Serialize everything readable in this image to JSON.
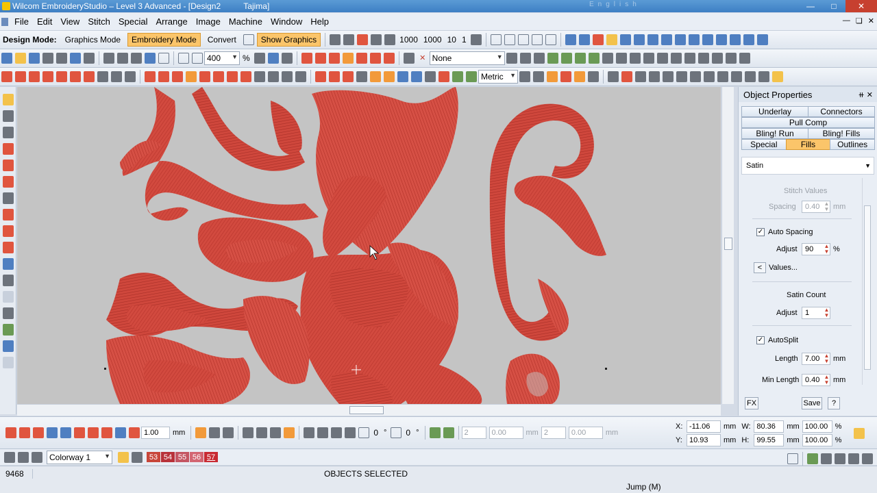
{
  "window": {
    "title": "Wilcom EmbroideryStudio – Level 3 Advanced - [Design2          Tajima]",
    "faint_text": "English"
  },
  "menu": [
    "File",
    "Edit",
    "View",
    "Stitch",
    "Special",
    "Arrange",
    "Image",
    "Machine",
    "Window",
    "Help"
  ],
  "toolbar1": {
    "design_mode_label": "Design Mode:",
    "graphics_mode": "Graphics Mode",
    "embroidery_mode": "Embroidery Mode",
    "convert": "Convert",
    "show_graphics": "Show Graphics",
    "digits": [
      "1000",
      "1000",
      "10",
      "1"
    ]
  },
  "toolbar2": {
    "zoom_value": "400",
    "zoom_unit": "%",
    "effect_none": "None"
  },
  "toolbar3": {
    "units": "Metric"
  },
  "panel": {
    "title": "Object Properties",
    "tabs_row1": [
      "Underlay",
      "Connectors"
    ],
    "tabs_row2": [
      "Pull Comp"
    ],
    "tabs_row3": [
      "Bling! Run",
      "Bling! Fills"
    ],
    "tabs_row4": [
      "Special",
      "Fills",
      "Outlines"
    ],
    "fill_type": "Satin",
    "stitch_values_label": "Stitch Values",
    "spacing_label": "Spacing",
    "spacing_value": "0.40",
    "mm": "mm",
    "auto_spacing_label": "Auto Spacing",
    "adjust_label": "Adjust",
    "adjust_value": "90",
    "percent": "%",
    "values_button": "Values...",
    "satin_count_label": "Satin Count",
    "satin_adjust_value": "1",
    "autosplit_label": "AutoSplit",
    "length_label": "Length",
    "length_value": "7.00",
    "min_length_label": "Min Length",
    "min_length_value": "0.40",
    "fx_button": "FX",
    "save_button": "Save",
    "help_button": "?"
  },
  "bottom_toolbar": {
    "spacing_value": "1.00",
    "spacing_unit": "mm",
    "angle1": "0",
    "angle2": "0",
    "count1": "2",
    "field1": "0.00",
    "count2": "2",
    "field2": "0.00",
    "coords": {
      "x_label": "X:",
      "x_value": "-11.06",
      "y_label": "Y:",
      "y_value": "10.93",
      "w_label": "W:",
      "w_value": "80.36",
      "h_label": "H:",
      "h_value": "99.55",
      "unit": "mm",
      "w_pct": "100.00",
      "h_pct": "100.00",
      "pct": "%"
    }
  },
  "colorway": {
    "label": "Colorway 1",
    "chips": [
      {
        "num": "53",
        "color": "#c8463a"
      },
      {
        "num": "54",
        "color": "#b8323a"
      },
      {
        "num": "55",
        "color": "#c45663"
      },
      {
        "num": "56",
        "color": "#d36672"
      },
      {
        "num": "57",
        "color": "#c82a32"
      }
    ]
  },
  "status": {
    "stitch_count": "9468",
    "message": "OBJECTS SELECTED",
    "jump": "Jump (M)"
  },
  "colors": {
    "accent": "#fbc56a",
    "embroidery_red": "#d0463b",
    "canvas": "#c4c4c4"
  }
}
